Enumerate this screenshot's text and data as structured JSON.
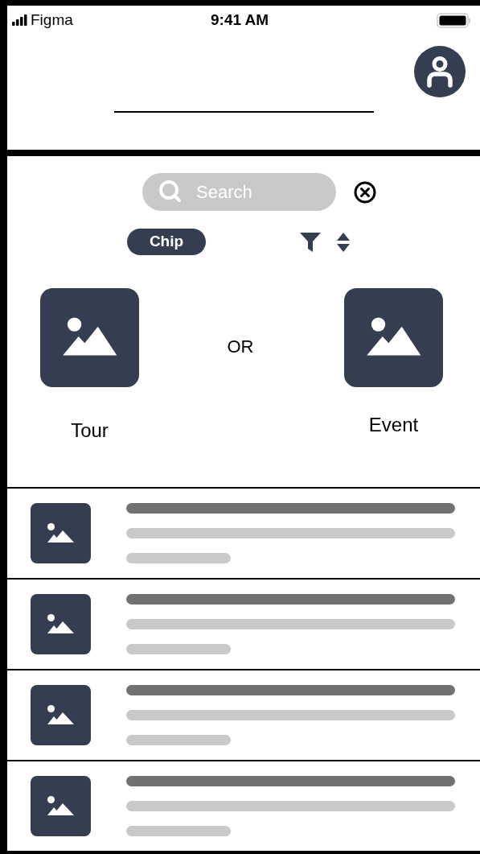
{
  "status_bar": {
    "carrier": "Figma",
    "time": "9:41 AM"
  },
  "search": {
    "placeholder": "Search"
  },
  "chip": {
    "label": "Chip"
  },
  "choices": [
    {
      "label": "Tour"
    },
    {
      "label": "Event"
    }
  ],
  "separator": "OR",
  "list": [
    {
      "kind": "placeholder"
    },
    {
      "kind": "placeholder"
    },
    {
      "kind": "placeholder"
    },
    {
      "kind": "placeholder"
    }
  ]
}
